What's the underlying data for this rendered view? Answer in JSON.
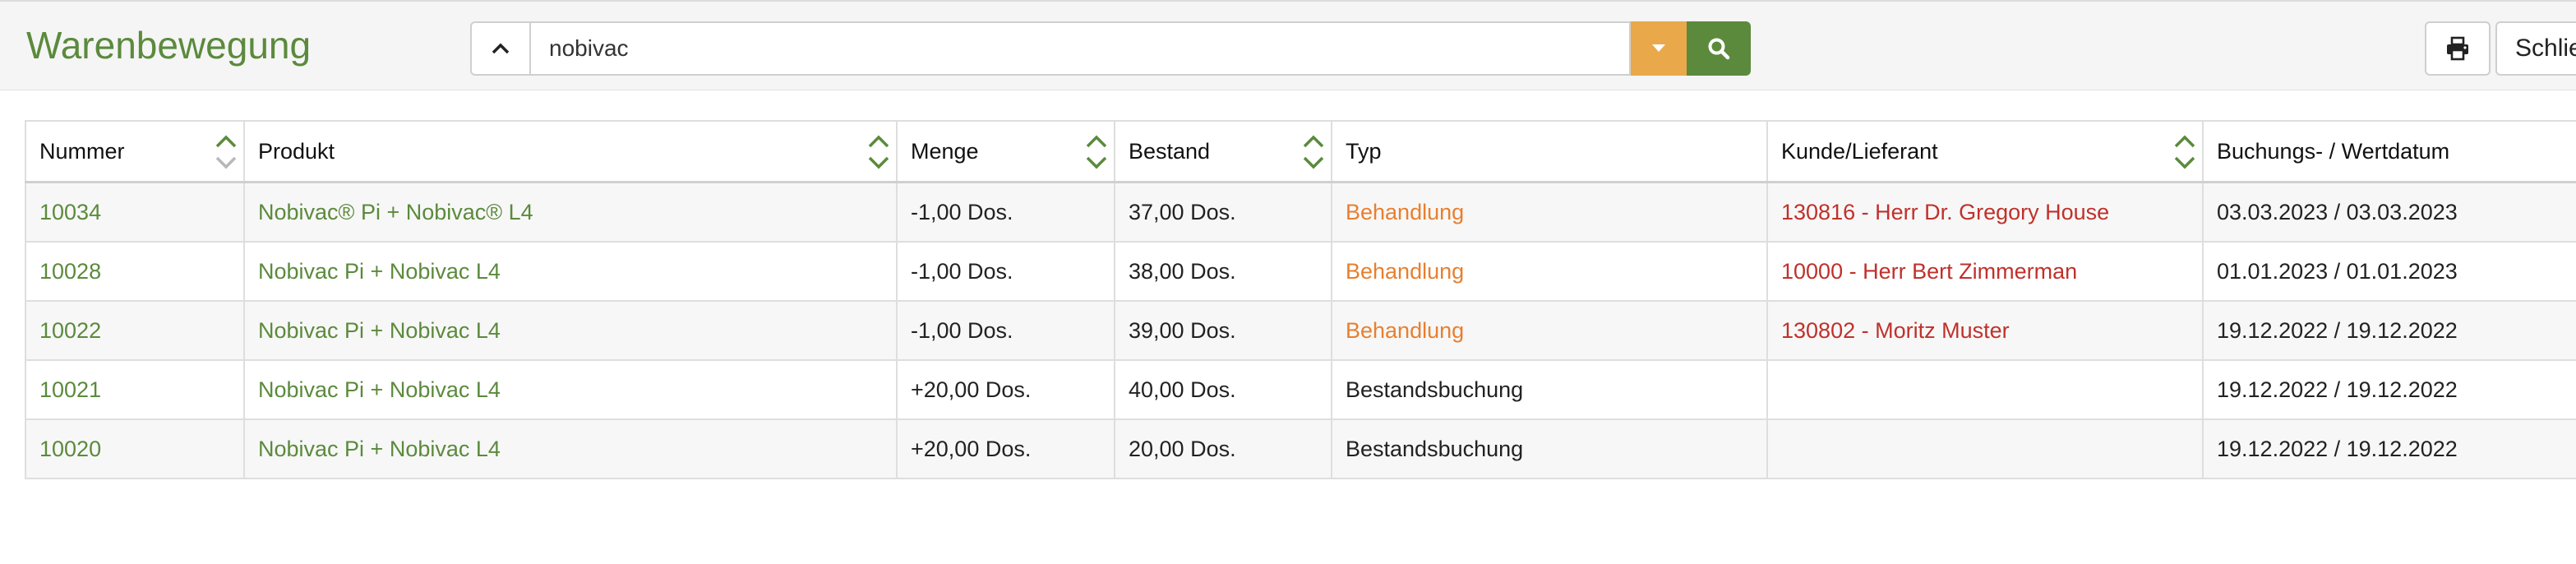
{
  "header": {
    "title": "Warenbewegung"
  },
  "search": {
    "value": "nobivac"
  },
  "toolbar": {
    "close_label": "Schließen"
  },
  "table": {
    "columns": [
      "Nummer",
      "Produkt",
      "Menge",
      "Bestand",
      "Typ",
      "Kunde/Lieferant",
      "Buchungs- / Wertdatum"
    ],
    "rows": [
      {
        "nummer": "10034",
        "produkt": "Nobivac® Pi + Nobivac® L4",
        "menge": "-1,00 Dos.",
        "bestand": "37,00 Dos.",
        "typ": "Behandlung",
        "kunde": "130816 - Herr Dr. Gregory House",
        "datum": "03.03.2023 / 03.03.2023"
      },
      {
        "nummer": "10028",
        "produkt": "Nobivac Pi + Nobivac L4",
        "menge": "-1,00 Dos.",
        "bestand": "38,00 Dos.",
        "typ": "Behandlung",
        "kunde": "10000 - Herr Bert Zimmerman",
        "datum": "01.01.2023 / 01.01.2023"
      },
      {
        "nummer": "10022",
        "produkt": "Nobivac Pi + Nobivac L4",
        "menge": "-1,00 Dos.",
        "bestand": "39,00 Dos.",
        "typ": "Behandlung",
        "kunde": "130802 - Moritz Muster",
        "datum": "19.12.2022 / 19.12.2022"
      },
      {
        "nummer": "10021",
        "produkt": "Nobivac Pi + Nobivac L4",
        "menge": "+20,00 Dos.",
        "bestand": "40,00 Dos.",
        "typ": "Bestandsbuchung",
        "kunde": "",
        "datum": "19.12.2022 / 19.12.2022"
      },
      {
        "nummer": "10020",
        "produkt": "Nobivac Pi + Nobivac L4",
        "menge": "+20,00 Dos.",
        "bestand": "20,00 Dos.",
        "typ": "Bestandsbuchung",
        "kunde": "",
        "datum": "19.12.2022 / 19.12.2022"
      }
    ]
  },
  "colors": {
    "brand_green": "#5b8a3c",
    "warning_orange": "#e9a94b",
    "type_orange": "#e87f2e",
    "customer_red": "#c0312b"
  },
  "icons": {
    "collapse": "chevron-up-icon",
    "dropdown": "caret-down-icon",
    "search": "search-icon",
    "print": "print-icon",
    "sort": "sort-arrows-icon"
  }
}
